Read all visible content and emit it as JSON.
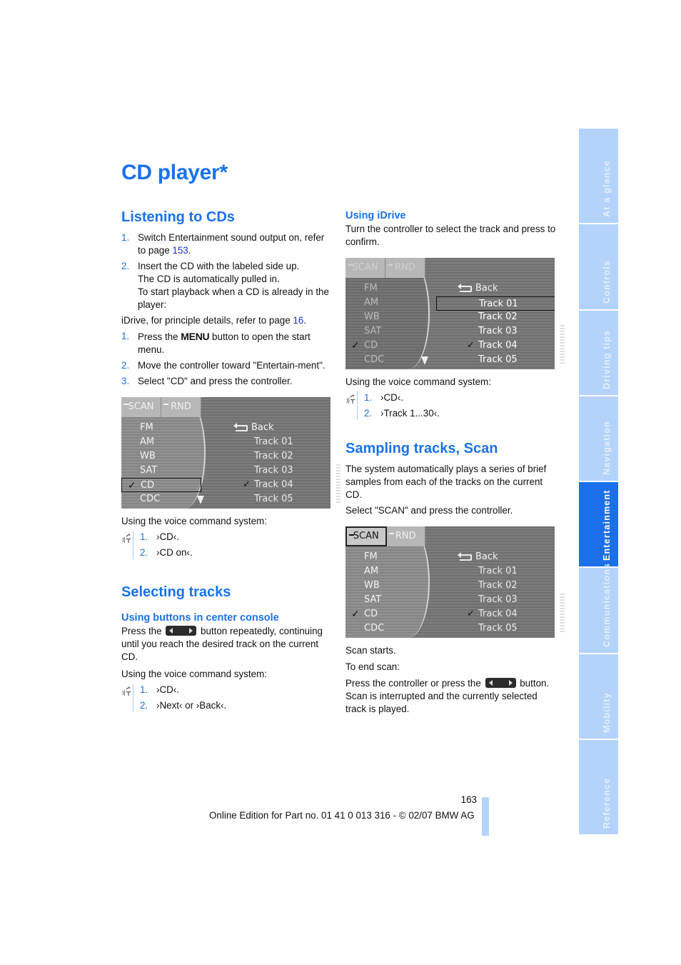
{
  "page": {
    "title": "CD player*",
    "page_number": "163",
    "footer": "Online Edition for Part no. 01 41 0 013 316 - © 02/07 BMW AG"
  },
  "sidebar": {
    "tabs": [
      {
        "label": "At a glance",
        "active": false
      },
      {
        "label": "Controls",
        "active": false
      },
      {
        "label": "Driving tips",
        "active": false
      },
      {
        "label": "Navigation",
        "active": false
      },
      {
        "label": "Entertainment",
        "active": true
      },
      {
        "label": "Communications",
        "active": false
      },
      {
        "label": "Mobility",
        "active": false
      },
      {
        "label": "Reference",
        "active": false
      }
    ],
    "colors": {
      "inactive": "#b3d3fb",
      "active": "#1b6fe8"
    }
  },
  "listening": {
    "heading": "Listening to CDs",
    "steps1": [
      {
        "num": "1.",
        "text_a": "Switch Entertainment sound output on, refer to page ",
        "link": "153",
        "text_b": "."
      },
      {
        "num": "2.",
        "lines": [
          "Insert the CD with the labeled side up.",
          "The CD is automatically pulled in.",
          "To start playback when a CD is already in the player:"
        ]
      }
    ],
    "idrive_note_a": "iDrive, for principle details, refer to page ",
    "idrive_note_link": "16",
    "idrive_note_b": ".",
    "steps2": [
      {
        "num": "1.",
        "text_a": "Press the ",
        "menu": "MENU",
        "text_b": " button to open the start menu."
      },
      {
        "num": "2.",
        "text": "Move the controller toward \"Entertain-ment\"."
      },
      {
        "num": "3.",
        "text": "Select \"CD\" and press the controller."
      }
    ],
    "voice_intro": "Using the voice command system:",
    "voice_steps": [
      {
        "num": "1.",
        "text": "›CD‹."
      },
      {
        "num": "2.",
        "text": "›CD on‹."
      }
    ]
  },
  "screen_common": {
    "tab_scan": "SCAN",
    "tab_rnd": "RND",
    "sources": [
      "FM",
      "AM",
      "WB",
      "SAT",
      "CD",
      "CDC"
    ],
    "checked_source": "CD",
    "back": "Back",
    "tracks": [
      "Track  01",
      "Track  02",
      "Track  03",
      "Track  04",
      "Track  05"
    ],
    "checked_track": "Track  04",
    "check_glyph": "✓"
  },
  "selecting": {
    "heading": "Selecting tracks",
    "sub_buttons": "Using buttons in center console",
    "buttons_text_a": "Press the ",
    "buttons_text_b": " button repeatedly, continuing until you reach the desired track on the current CD.",
    "voice_intro": "Using the voice command system:",
    "voice_steps": [
      {
        "num": "1.",
        "text": "›CD‹."
      },
      {
        "num": "2.",
        "text": "›Next‹ or ›Back‹."
      }
    ],
    "sub_idrive": "Using iDrive",
    "idrive_text": "Turn the controller to select the track and press to confirm.",
    "voice_intro2": "Using the voice command system:",
    "voice_steps2": [
      {
        "num": "1.",
        "text": "›CD‹."
      },
      {
        "num": "2.",
        "text": "›Track 1...30‹."
      }
    ]
  },
  "scan": {
    "heading": "Sampling tracks, Scan",
    "intro": "The system automatically plays a series of brief samples from each of the tracks on the current CD.",
    "select": "Select \"SCAN\" and press the controller.",
    "starts": "Scan starts.",
    "end_label": "To end scan:",
    "end_text_a": "Press the controller or press the ",
    "end_text_b": " button. Scan is interrupted and the currently selected track is played."
  }
}
